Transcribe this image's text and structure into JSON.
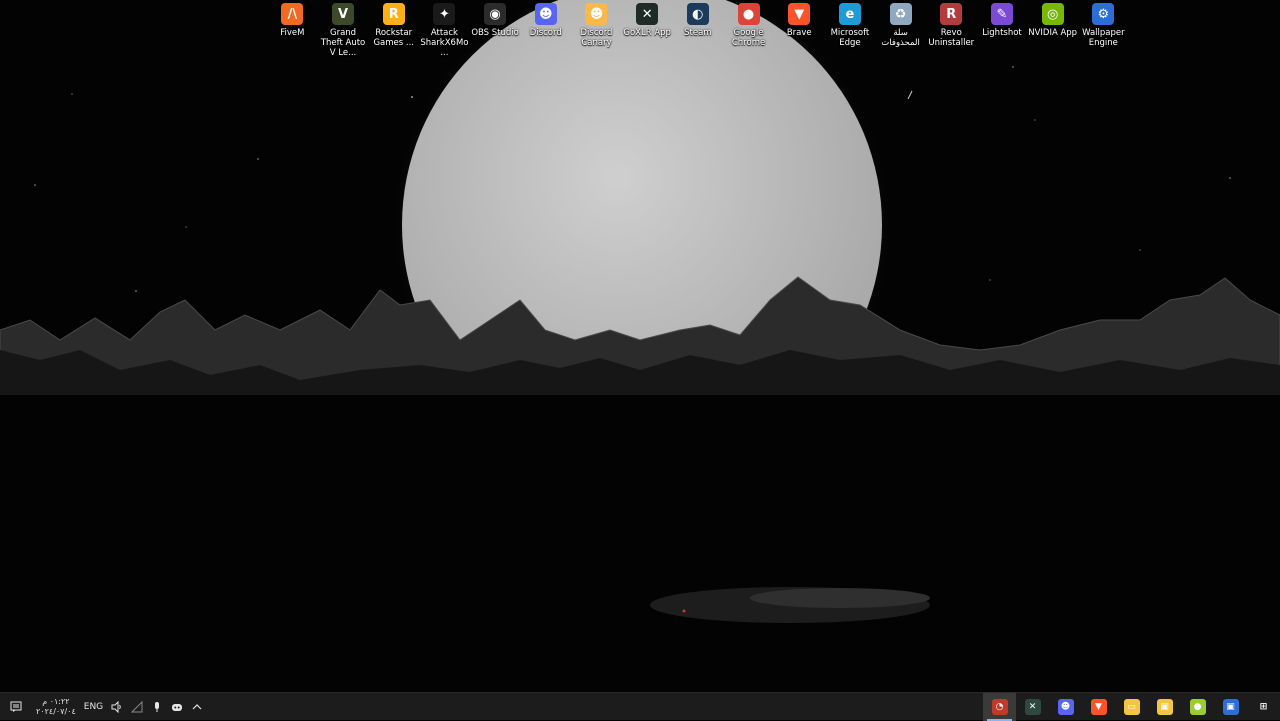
{
  "desktop_icons": [
    {
      "label": "FiveM",
      "icon": "fivem-icon",
      "color": "#f06a22",
      "glyph": "/\\"
    },
    {
      "label": "Grand Theft Auto V Le...",
      "icon": "gta-v-icon",
      "color": "#3d4a2a",
      "glyph": "V"
    },
    {
      "label": "Rockstar Games ...",
      "icon": "rockstar-icon",
      "color": "#fcaf17",
      "glyph": "R"
    },
    {
      "label": "Attack SharkX6Mo...",
      "icon": "attack-shark-icon",
      "color": "#1a1a1a",
      "glyph": "✦"
    },
    {
      "label": "OBS Studio",
      "icon": "obs-icon",
      "color": "#2b2b2b",
      "glyph": "◉"
    },
    {
      "label": "Discord",
      "icon": "discord-icon",
      "color": "#5865f2",
      "glyph": "☻"
    },
    {
      "label": "Discord Canary",
      "icon": "discord-canary-icon",
      "color": "#fbb848",
      "glyph": "☻"
    },
    {
      "label": "GoXLR App",
      "icon": "goxlr-icon",
      "color": "#1f2b26",
      "glyph": "✕"
    },
    {
      "label": "Steam",
      "icon": "steam-icon",
      "color": "#1b3a5c",
      "glyph": "◐"
    },
    {
      "label": "Google Chrome",
      "icon": "chrome-icon",
      "color": "#db4437",
      "glyph": "●"
    },
    {
      "label": "Brave",
      "icon": "brave-icon",
      "color": "#fb542b",
      "glyph": "▼"
    },
    {
      "label": "Microsoft Edge",
      "icon": "edge-icon",
      "color": "#1c9bd8",
      "glyph": "e"
    },
    {
      "label": "سلة المحذوفات",
      "icon": "recycle-bin-icon",
      "color": "#8fa7c0",
      "glyph": "♻"
    },
    {
      "label": "Revo Uninstaller",
      "icon": "revo-uninstaller-icon",
      "color": "#b33b3b",
      "glyph": "R"
    },
    {
      "label": "Lightshot",
      "icon": "lightshot-icon",
      "color": "#7b4bd6",
      "glyph": "✎"
    },
    {
      "label": "NVIDIA App",
      "icon": "nvidia-icon",
      "color": "#76b900",
      "glyph": "◎"
    },
    {
      "label": "Wallpaper Engine",
      "icon": "wallpaper-engine-icon",
      "color": "#2b6fd6",
      "glyph": "⚙"
    }
  ],
  "taskbar": {
    "clock_time": "٠١:٢٢ م",
    "clock_date": "٢٠٢٤/٠٧/٠٤",
    "language": "ENG",
    "apps": [
      {
        "name": "lightshot-task-icon",
        "color": "#c0392b",
        "glyph": "◔",
        "active": true
      },
      {
        "name": "goxlr-task-icon",
        "color": "#2e4a40",
        "glyph": "✕",
        "active": false
      },
      {
        "name": "discord-task-icon",
        "color": "#5865f2",
        "glyph": "☻",
        "active": false
      },
      {
        "name": "brave-task-icon",
        "color": "#fb542b",
        "glyph": "▼",
        "active": false
      },
      {
        "name": "file-explorer-task-icon",
        "color": "#f4c542",
        "glyph": "▭",
        "active": false
      },
      {
        "name": "microsoft-store-task-icon",
        "color": "#f4c542",
        "glyph": "▣",
        "active": false
      },
      {
        "name": "tennis-ball-task-icon",
        "color": "#9acd32",
        "glyph": "●",
        "active": false
      },
      {
        "name": "remote-desktop-task-icon",
        "color": "#2b6fd6",
        "glyph": "▣",
        "active": false
      },
      {
        "name": "start-menu-icon",
        "color": "#1c1c1c",
        "glyph": "⊞",
        "active": false
      }
    ]
  }
}
